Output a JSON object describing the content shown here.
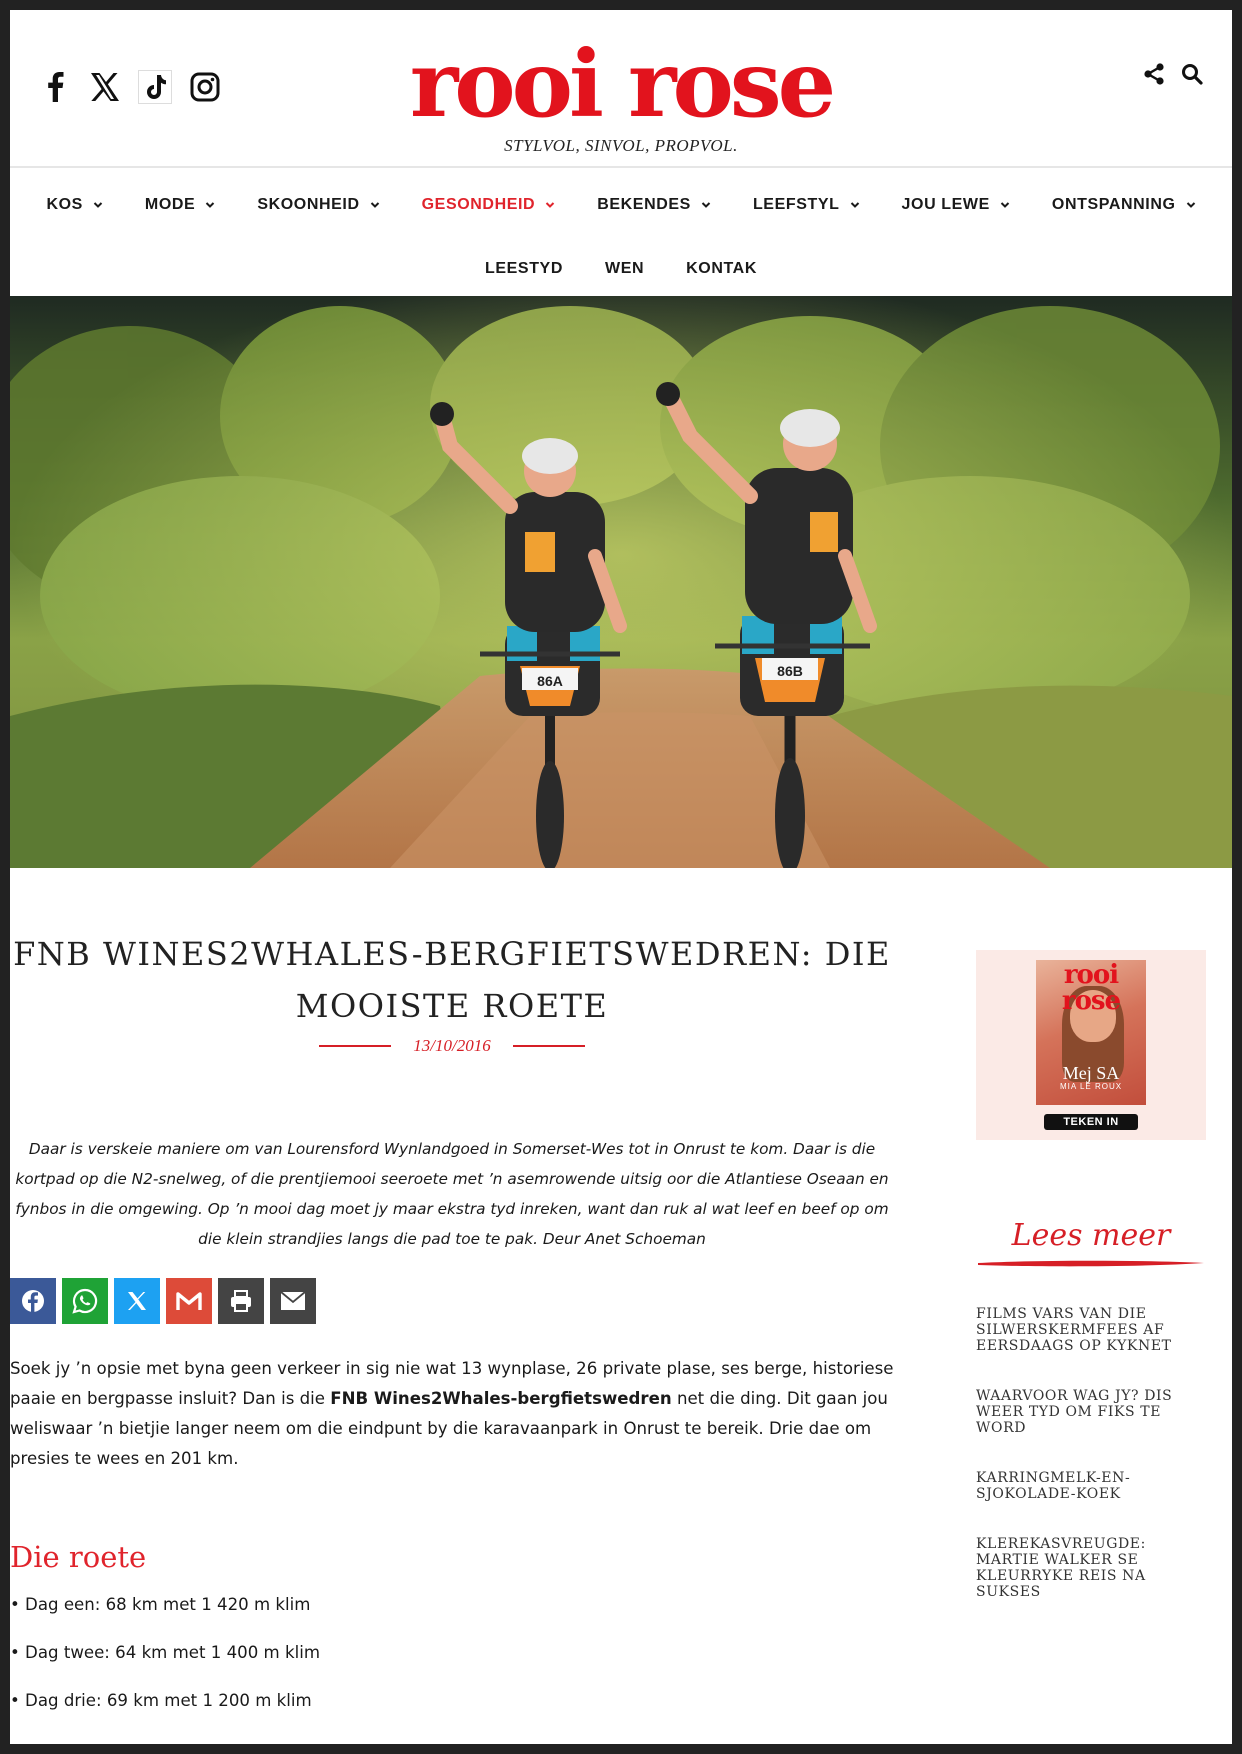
{
  "brand": {
    "logo": "rooi rose",
    "tagline": "STYLVOL, SINVOL, PROPVOL.",
    "accent": "#e0242c"
  },
  "social": [
    "facebook-icon",
    "x-icon",
    "tiktok-icon",
    "instagram-icon"
  ],
  "tools": [
    "share-icon",
    "search-icon"
  ],
  "nav": {
    "row1": [
      {
        "label": "KOS",
        "dropdown": true
      },
      {
        "label": "MODE",
        "dropdown": true
      },
      {
        "label": "SKOONHEID",
        "dropdown": true
      },
      {
        "label": "GESONDHEID",
        "dropdown": true,
        "active": true
      },
      {
        "label": "BEKENDES",
        "dropdown": true
      },
      {
        "label": "LEEFSTYL",
        "dropdown": true
      },
      {
        "label": "JOU LEWE",
        "dropdown": true
      },
      {
        "label": "ONTSPANNING",
        "dropdown": true
      }
    ],
    "row2": [
      {
        "label": "LEESTYD"
      },
      {
        "label": "WEN"
      },
      {
        "label": "KONTAK"
      }
    ]
  },
  "hero": {
    "bib_left": "86A",
    "bib_right": "86B"
  },
  "article": {
    "title": "FNB WINES2WHALES-BERGFIETSWEDREN: DIE MOOISTE ROETE",
    "date": "13/10/2016",
    "intro": "Daar is verskeie maniere om van Lourensford Wynlandgoed in Somerset-Wes tot in Onrust te kom. Daar is die kortpad op die N2-snelweg, of die prentjiemooi seeroete met ’n asemrowende uitsig oor die Atlantiese Oseaan en fynbos in die omgewing. Op ’n mooi dag moet jy maar ekstra tyd inreken, want dan ruk al wat leef en beef op om die klein strandjies langs die pad toe te pak. Deur Anet Schoeman",
    "share": [
      {
        "icon": "facebook-icon",
        "color": "#3b5998"
      },
      {
        "icon": "whatsapp-icon",
        "color": "#1fa336"
      },
      {
        "icon": "x-icon",
        "color": "#1da1f2"
      },
      {
        "icon": "gmail-icon",
        "color": "#dd4b39"
      },
      {
        "icon": "print-icon",
        "color": "#444444"
      },
      {
        "icon": "email-icon",
        "color": "#444444"
      }
    ],
    "body_before": "Soek jy ’n opsie met byna geen verkeer in sig nie wat 13 wynplase, 26 private plase, ses berge, historiese paaie en bergpasse insluit? Dan is die ",
    "body_bold": "FNB Wines2Whales-bergfietswedren",
    "body_after": " net die ding. Dit gaan jou weliswaar ’n bietjie langer neem om die eindpunt by die karavaanpark in Onrust te bereik. Drie dae om presies te wees en 201 km.",
    "section_heading": "Die roete",
    "bullets": [
      "• Dag een: 68 km met 1 420 m klim",
      "• Dag twee: 64 km met 1 400 m klim",
      "• Dag drie: 69 km met 1 200 m klim"
    ]
  },
  "sidebar": {
    "magazine": {
      "logo": "rooi rose",
      "name": "Mej SA",
      "sub": "MIA LE ROUX",
      "button": "TEKEN IN"
    },
    "lees_meer": "Lees meer",
    "related": [
      "FILMS VARS VAN DIE SILWERSKERMFEES AF EERSDAAGS OP KYKNET",
      "WAARVOOR WAG JY? DIS WEER TYD OM FIKS TE WORD",
      "KARRINGMELK-EN-SJOKOLADE-KOEK",
      "KLEREKASVREUGDE: MARTIE WALKER SE KLEURRYKE REIS NA SUKSES"
    ]
  }
}
